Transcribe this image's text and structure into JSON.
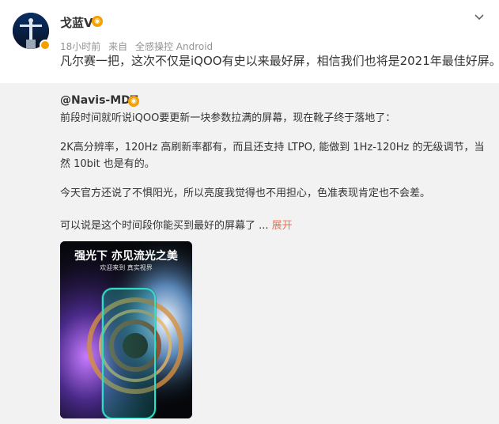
{
  "post": {
    "author": "戈蓝V",
    "vip_mark": "◉",
    "time": "18小时前",
    "source_prefix": "来自",
    "source": "全感操控 Android",
    "text": "凡尔赛一把，这次不仅是iQOO有史以来最好屏，相信我们也将是2021年最佳好屏。",
    "emoji_icon": "sunglasses-emoji-icon"
  },
  "repost": {
    "author": "@Navis-MDT",
    "badge_mark": "◉",
    "paragraphs": [
      "前段时间就听说iQOO要更新一块参数拉满的屏幕，现在靴子终于落地了：",
      "2K高分辨率，120Hz 高刷新率都有，而且还支持 LTPO, 能做到 1Hz-120Hz 的无级调节，当然 10bit 也是有的。",
      "今天官方还说了不惧阳光，所以亮度我觉得也不用担心，色准表现肯定也不会差。",
      "可以说是这个时间段你能买到最好的屏幕了 ..."
    ],
    "expand_label": "展开",
    "image": {
      "title": "强光下 亦见流光之美",
      "subtitle": "欢迎来到 真实视界"
    }
  },
  "colors": {
    "accent_orange": "#eb7350",
    "badge": "#f6a000",
    "repost_bg": "#f2f2f2",
    "meta_text": "#939393"
  }
}
